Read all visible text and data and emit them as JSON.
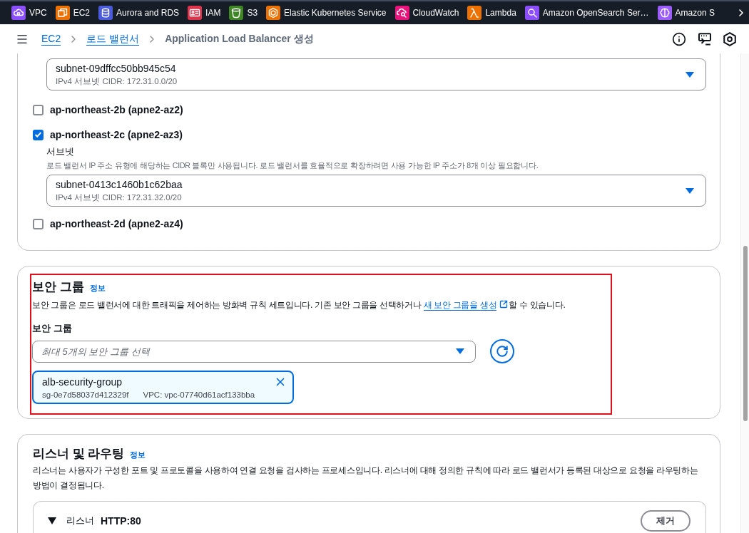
{
  "top_nav": {
    "services": [
      {
        "label": "VPC",
        "color": "#8c4fff"
      },
      {
        "label": "EC2",
        "color": "#ed7100"
      },
      {
        "label": "Aurora and RDS",
        "color": "#4a5bdc"
      },
      {
        "label": "IAM",
        "color": "#dd344c"
      },
      {
        "label": "S3",
        "color": "#3f8624"
      },
      {
        "label": "Elastic Kubernetes Service",
        "color": "#ed7100"
      },
      {
        "label": "CloudWatch",
        "color": "#e7157b"
      },
      {
        "label": "Lambda",
        "color": "#ed7100"
      },
      {
        "label": "Amazon OpenSearch Ser…",
        "color": "#8c4fff"
      },
      {
        "label": "Amazon S",
        "color": "#9d5cff"
      }
    ]
  },
  "breadcrumbs": [
    {
      "label": "EC2",
      "kind": "link"
    },
    {
      "label": "로드 밸런서",
      "kind": "link"
    },
    {
      "label": "Application Load Balancer 생성",
      "kind": "current"
    }
  ],
  "network_mapping": {
    "top_subnet_select": {
      "value": "subnet-09dffcc50bb945c54",
      "detail": "IPv4 서브넷 CIDR: 172.31.0.0/20"
    },
    "zones": [
      {
        "label": "ap-northeast-2b (apne2-az2)",
        "checked": false
      },
      {
        "label": "ap-northeast-2c (apne2-az3)",
        "checked": true,
        "subnet": {
          "label": "서브넷",
          "hint": "로드 밸런서 IP 주소 유형에 해당하는 CIDR 블록만 사용됩니다. 로드 밸런서를 효율적으로 확장하려면 사용 가능한 IP 주소가 8개 이상 필요합니다.",
          "value": "subnet-0413c1460b1c62baa",
          "detail": "IPv4 서브넷 CIDR: 172.31.32.0/20"
        }
      },
      {
        "label": "ap-northeast-2d (apne2-az4)",
        "checked": false
      }
    ]
  },
  "security_groups": {
    "highlighted": true,
    "title": "보안 그룹",
    "info_link": "정보",
    "description_start": "보안 그룹은 로드 밸런서에 대한 트래픽을 제어하는 방화벽 규칙 세트입니다. 기존 보안 그룹을 선택하거나 ",
    "create_link": "새 보안 그룹을 생성",
    "description_end": "할 수 있습니다.",
    "field_label": "보안 그룹",
    "placeholder": "최대 5개의 보안 그룹 선택",
    "selected_groups": [
      {
        "name": "alb-security-group",
        "group_id": "sg-0e7d58037d412329f",
        "vpc": "VPC: vpc-07740d61acf133bba"
      }
    ]
  },
  "listeners_routing": {
    "title": "리스너 및 라우팅",
    "info_link": "정보",
    "description": "리스너는 사용자가 구성한 포트 및 프로토콜을 사용하여 연결 요청을 검사하는 프로세스입니다. 리스너에 대해 정의한 규칙에 따라 로드 밸런서가 등록된 대상으로 요청을 라우팅하는 방법이 결정됩니다.",
    "listeners": [
      {
        "expanded": true,
        "label": "리스너",
        "protocol": "HTTP:80",
        "remove_button": "제거"
      }
    ]
  }
}
